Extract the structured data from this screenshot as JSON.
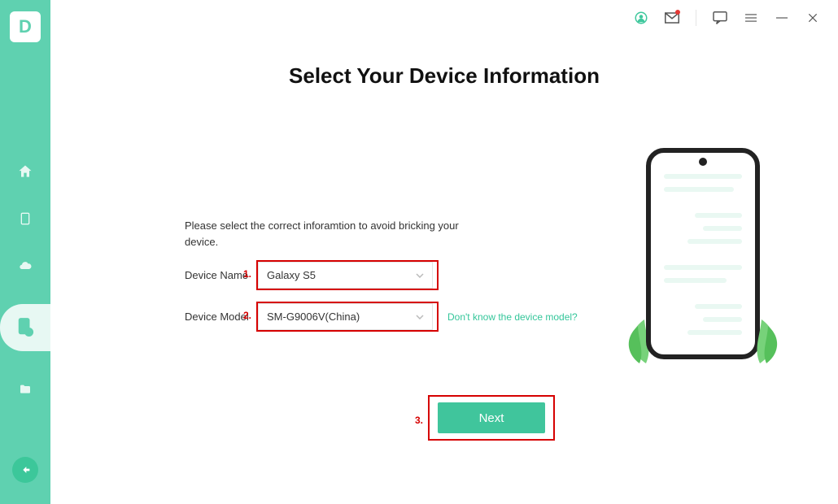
{
  "app": {
    "logo_letter": "D"
  },
  "titlebar": {},
  "page": {
    "title": "Select Your Device Information",
    "instruction": "Please select the correct inforamtion to avoid bricking your device."
  },
  "form": {
    "device_name": {
      "label": "Device Name",
      "value": "Galaxy S5",
      "marker": "1."
    },
    "device_model": {
      "label": "Device Model",
      "value": "SM-G9006V(China)",
      "marker": "2."
    },
    "help_link": "Don't know the device model?"
  },
  "actions": {
    "next_label": "Next",
    "next_marker": "3."
  }
}
